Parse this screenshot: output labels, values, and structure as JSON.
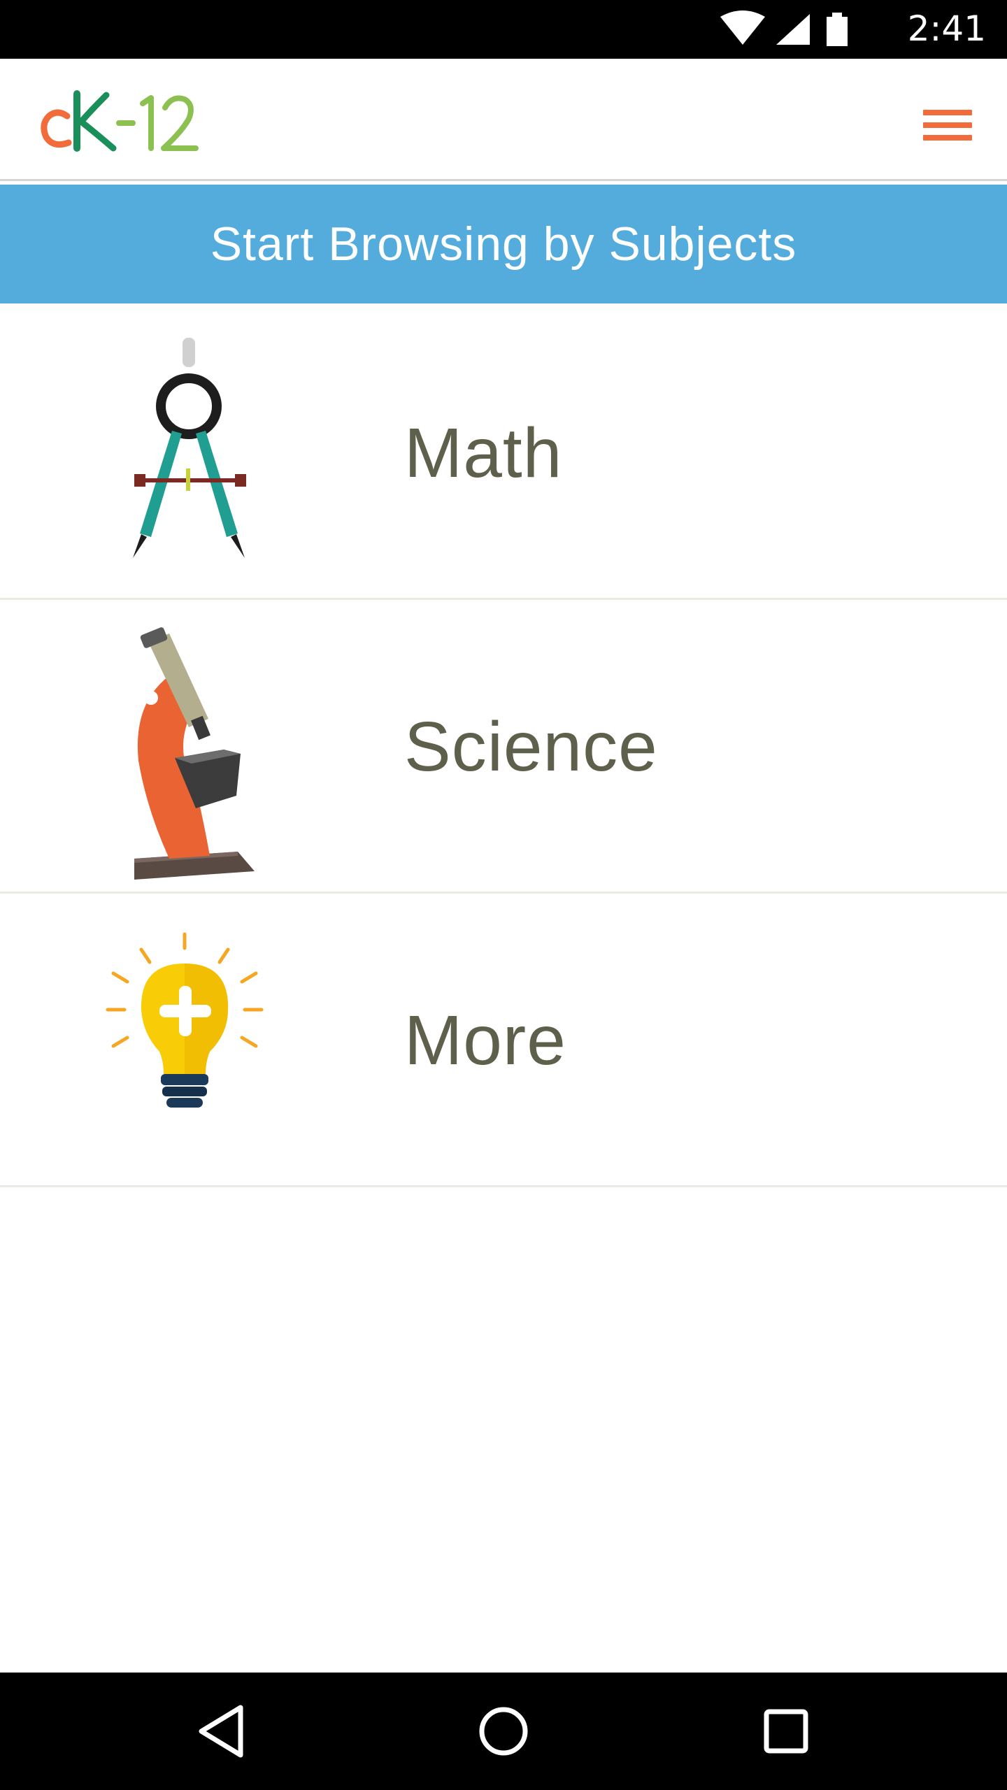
{
  "status_bar": {
    "time": "2:41",
    "icons": [
      "wifi-icon",
      "signal-icon",
      "battery-icon"
    ]
  },
  "header": {
    "logo_text": "cK-12",
    "menu_icon": "hamburger-menu-icon"
  },
  "banner": {
    "title": "Start Browsing by Subjects"
  },
  "subjects": [
    {
      "label": "Math",
      "icon": "compass-icon"
    },
    {
      "label": "Science",
      "icon": "microscope-icon"
    },
    {
      "label": "More",
      "icon": "lightbulb-icon"
    }
  ],
  "nav_bar": {
    "buttons": [
      "back-icon",
      "home-icon",
      "recents-icon"
    ]
  },
  "colors": {
    "brand_orange": "#f26b3a",
    "brand_green": "#8cc152",
    "banner_blue": "#54acdc",
    "label_text": "#5f604b"
  }
}
